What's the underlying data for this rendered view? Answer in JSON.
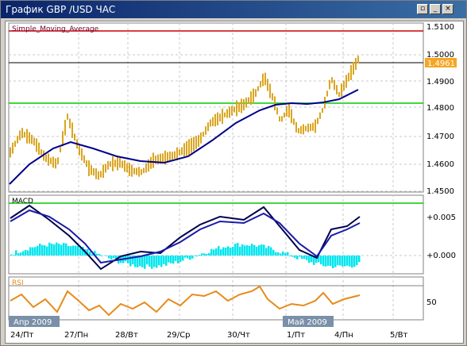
{
  "window": {
    "title": "График GBP /USD  ЧАС",
    "buttons": [
      "restore",
      "minimize",
      "close"
    ]
  },
  "main_chart": {
    "indicator_label": "Simple_Moving_Average",
    "current_price": "1.4961",
    "price_axis_labels": [
      "1.5100",
      "1.5000",
      "1.4900",
      "1.4800",
      "1.4700",
      "1.4600",
      "1.4500"
    ]
  },
  "macd_panel": {
    "label": "MACD",
    "axis_labels": [
      "+0.005",
      "+0.000"
    ]
  },
  "rsi_panel": {
    "label": "RSI",
    "axis_label": "50"
  },
  "time_axis": {
    "labels": [
      "24/Пт",
      "27/Пн",
      "28/Вт",
      "29/Ср",
      "30/Чт",
      "1/Пт",
      "4/Пн",
      "5/Вт"
    ],
    "month_badges": [
      "Апр 2009",
      "Май 2009"
    ]
  },
  "colors": {
    "candles": "#daa520",
    "sma": "#00008b",
    "red_line": "#cc0000",
    "green_line": "#00cc00",
    "macd_hist": "#00e5ee",
    "rsi": "#e88a1a",
    "price_tag": "#f5a623"
  }
}
